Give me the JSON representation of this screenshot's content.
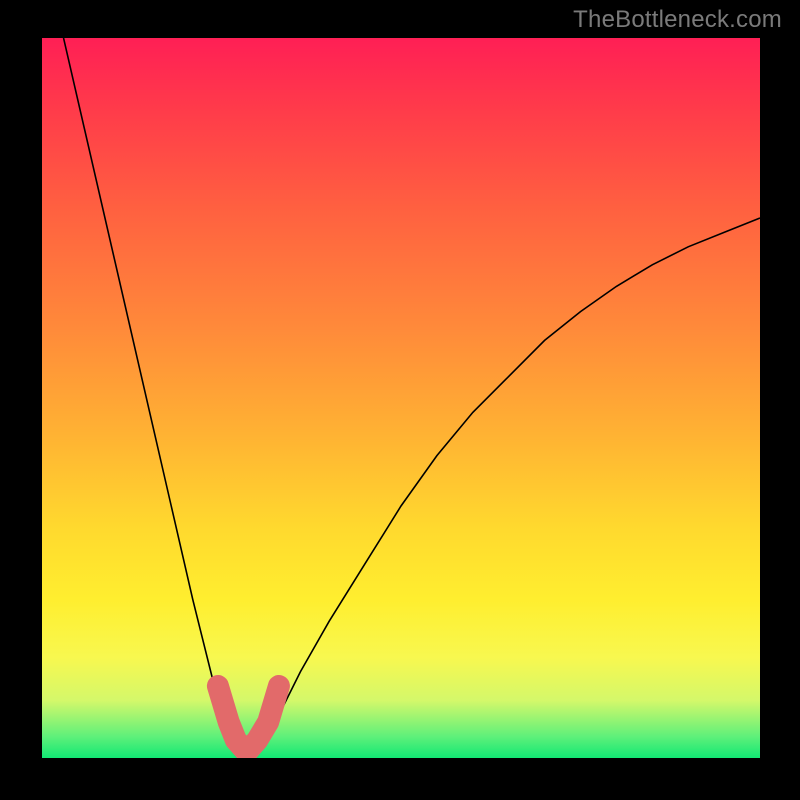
{
  "watermark": "TheBottleneck.com",
  "chart_data": {
    "type": "line",
    "title": "",
    "xlabel": "",
    "ylabel": "",
    "xlim": [
      0,
      100
    ],
    "ylim": [
      0,
      100
    ],
    "grid": false,
    "legend": false,
    "series": [
      {
        "name": "bottleneck-curve",
        "x": [
          3,
          6,
          9,
          12,
          15,
          18,
          21,
          24,
          25.5,
          27,
          28.5,
          30,
          33,
          36,
          40,
          45,
          50,
          55,
          60,
          65,
          70,
          75,
          80,
          85,
          90,
          95,
          100
        ],
        "values": [
          100,
          87,
          74,
          61,
          48,
          35,
          22,
          10,
          5,
          2,
          0.5,
          2,
          6,
          12,
          19,
          27,
          35,
          42,
          48,
          53,
          58,
          62,
          65.5,
          68.5,
          71,
          73,
          75
        ]
      }
    ],
    "annotations": [
      {
        "name": "minimum-marker",
        "x": [
          24.5,
          26,
          27,
          28.5,
          30,
          31.5,
          33
        ],
        "values": [
          10,
          5,
          2.5,
          0.8,
          2.5,
          5,
          10
        ],
        "color": "#e26a6a"
      }
    ],
    "background_gradient": {
      "top": "#ff1f55",
      "bottom": "#12e874",
      "stops": [
        "#ff1f55",
        "#ff893a",
        "#ffd92e",
        "#f8f84f",
        "#12e874"
      ]
    }
  }
}
